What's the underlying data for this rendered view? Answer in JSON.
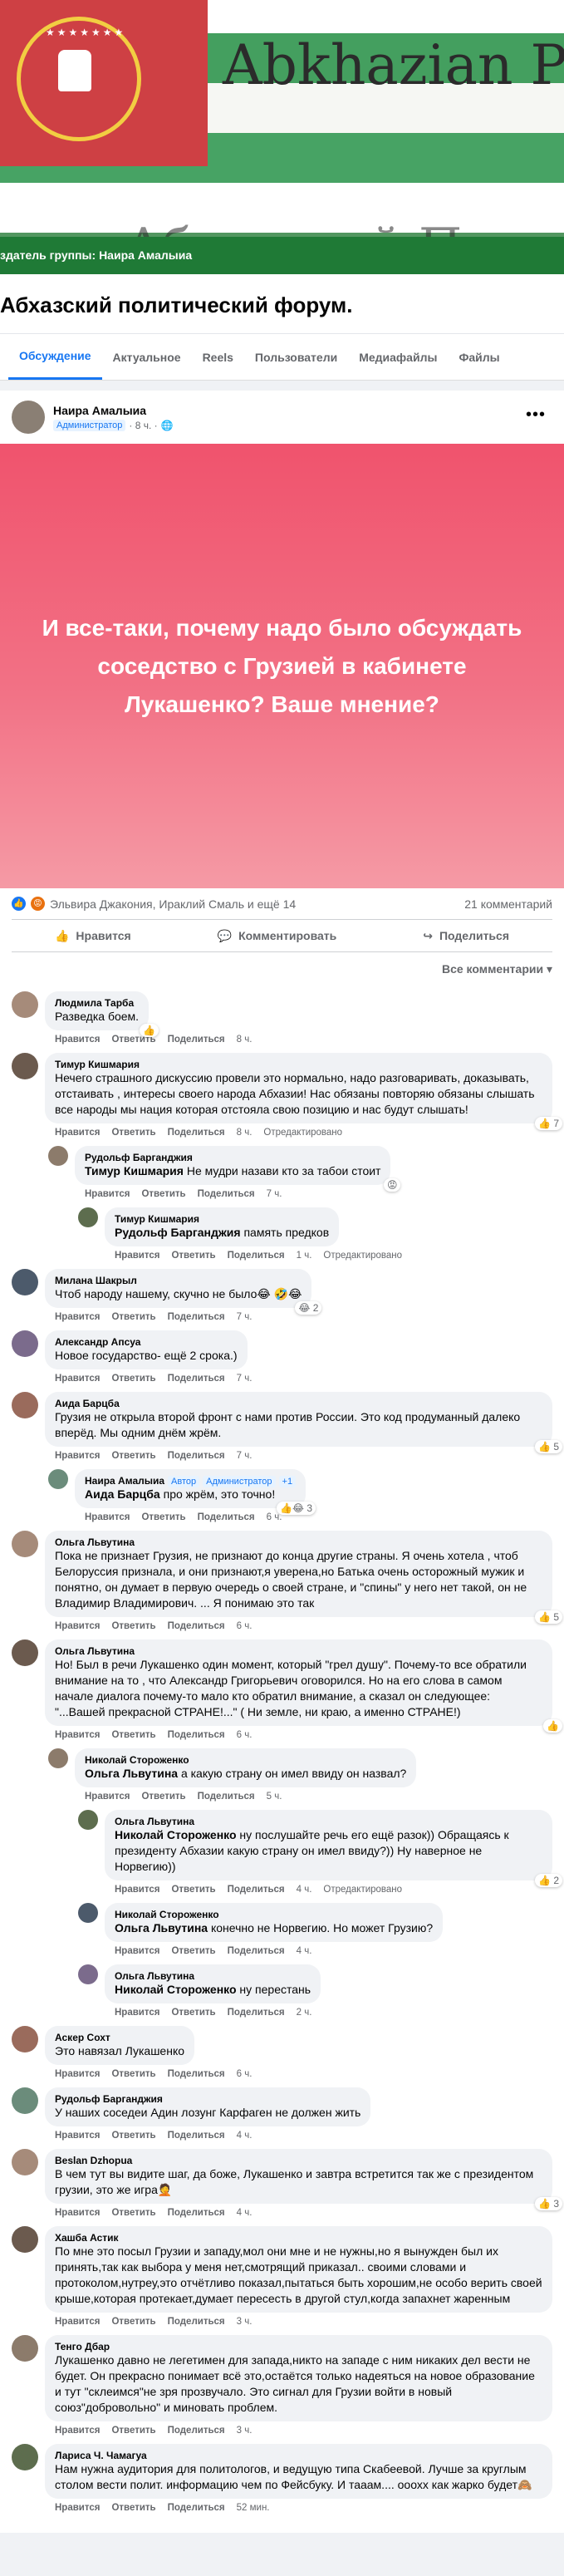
{
  "cover": {
    "brand": "Abkhazian Po",
    "brand_ghost": "Абхазский Полит",
    "admin_line": "здатель группы: Наира Амалыиа"
  },
  "group": {
    "title": "Абхазский политический форум.",
    "tabs": [
      "Обсуждение",
      "Актуальное",
      "Reels",
      "Пользователи",
      "Медиафайлы",
      "Файлы"
    ]
  },
  "post": {
    "author": "Наира Амалыиа",
    "role": "Администратор",
    "time": "· 8 ч. ·",
    "banner_text": "И все-таки, почему надо было обсуждать соседство с Грузией в кабинете Лукашенко? Ваше мнение?",
    "reactions_text": "Эльвира Джакония, Ираклий Смаль и ещё 14",
    "comments_count": "21 комментарий",
    "actions": {
      "like": "Нравится",
      "comment": "Комментировать",
      "share": "Поделиться"
    },
    "sort_label": "Все комментарии"
  },
  "comment_actions": {
    "like": "Нравится",
    "reply": "Ответить",
    "share": "Поделиться",
    "edited": "Отредактировано"
  },
  "comments": [
    {
      "name": "Людмила Тарба",
      "text": "Разведка боем.",
      "time": "8 ч.",
      "level": 0,
      "react": "👍"
    },
    {
      "name": "Тимур Кишмария",
      "text": "Нечего страшного дискуссию провели это нормально, надо разговаривать, доказывать, отстаивать , интересы своего народа Абхазии! Нас обязаны повторяю обязаны слышать все народы мы нация которая отстояла свою позицию и нас будут слышать!",
      "time": "8 ч.",
      "edited": true,
      "level": 0,
      "react": "👍 7"
    },
    {
      "name": "Рудольф Барганджия",
      "tag": "Тимур Кишмария",
      "text": "Не мудри назави кто за табои стоит",
      "time": "7 ч.",
      "level": 1,
      "react": "😡"
    },
    {
      "name": "Тимур Кишмария",
      "tag": "Рудольф Барганджия",
      "text": "память предков",
      "time": "1 ч.",
      "edited": true,
      "level": 2
    },
    {
      "name": "Милана Шакрыл",
      "text": "Чтоб народу нашему, скучно не было😂 🤣😂",
      "time": "7 ч.",
      "level": 0,
      "react": "😂 2"
    },
    {
      "name": "Александр Апсуа",
      "text": "Новое государство- ещё 2 срока.)",
      "time": "7 ч.",
      "level": 0
    },
    {
      "name": "Аида Барцба",
      "text": "Грузия не открыла второй фронт с нами против России. Это код продуманный далеко вперёд. Мы одним днём жрём.",
      "time": "7 ч.",
      "level": 0,
      "react": "👍 5"
    },
    {
      "name": "Наира Амалыиа",
      "author_badges": [
        "Автор",
        "Администратор",
        "+1"
      ],
      "tag": "Аида Барцба",
      "text": "про жрём, это точно!",
      "time": "6 ч.",
      "level": 1,
      "react": "👍😂 3"
    },
    {
      "name": "Ольга Львутина",
      "text": "Пока не признает Грузия, не признают до конца другие страны. Я очень хотела , чтоб Белоруссия признала, и они признают,я уверена,но Батька очень осторожный мужик и понятно, он думает в первую очередь о своей стране, и \"спины\" у него нет такой, он не Владимир Владимирович. ... Я понимаю это так",
      "time": "6 ч.",
      "level": 0,
      "react": "👍 5"
    },
    {
      "name": "Ольга Львутина",
      "text": "Но! Был в речи Лукашенко один момент, который \"грел душу\". Почему-то все обратили внимание на то , что Александр Григорьевич оговорился. Но на его слова в самом начале диалога почему-то мало кто обратил внимание, а сказал он следующее: \"...Вашей прекрасной СТРАНЕ!...\" ( Ни земле, ни краю, а именно СТРАНЕ!)",
      "time": "6 ч.",
      "level": 0,
      "react": "👍"
    },
    {
      "name": "Николай Стороженко",
      "tag": "Ольга Львутина",
      "text": "а какую страну он имел ввиду он назвал?",
      "time": "5 ч.",
      "level": 1
    },
    {
      "name": "Ольга Львутина",
      "tag": "Николай Стороженко",
      "text": "ну послушайте речь его ещё разок)) Обращаясь к президенту Абхазии какую страну он имел ввиду?)) Ну наверное не Норвегию))",
      "time": "4 ч.",
      "edited": true,
      "level": 2,
      "react": "👍 2"
    },
    {
      "name": "Николай Стороженко",
      "tag": "Ольга Львутина",
      "text": "конечно не Норвегию. Но может Грузию?",
      "time": "4 ч.",
      "level": 2
    },
    {
      "name": "Ольга Львутина",
      "tag": "Николай Стороженко",
      "text": "ну перестань",
      "time": "2 ч.",
      "level": 2
    },
    {
      "name": "Аскер Сохт",
      "text": "Это навязал Лукашенко",
      "time": "6 ч.",
      "level": 0
    },
    {
      "name": "Рудольф Барганджия",
      "text": "У наших соседеи Адин лозунг Карфаген не должен жить",
      "time": "4 ч.",
      "level": 0
    },
    {
      "name": "Beslan Dzhopua",
      "text": "В чем тут вы видите шаг, да боже, Лукашенко и завтра встретится так же с президентом грузии, это же игра🤦",
      "time": "4 ч.",
      "level": 0,
      "react": "👍 3"
    },
    {
      "name": "Хашба Астик",
      "text": "По мне это посыл Грузии и западу,мол они мне и не нужны,но я вынужден был их принять,так как выбора у меня нет,смотрящий приказал.. своими словами и протоколом,нутреу,это отчётливо показал,пытаться быть хорошим,не особо верить своей крыше,которая протекает,думает пересесть в другой стул,когда запахнет жаренным",
      "time": "3 ч.",
      "level": 0
    },
    {
      "name": "Тенго Дбар",
      "text": "Лукашенко давно не легетимен для запада,никто на западе с ним никаких дел вести не будет. Он прекрасно понимает всё это,остаётся только надеяться на новое образование и тут \"склеимся\"не зря прозвучало. Это сигнал для Грузии войти в новый союз\"добровольно\" и миновать проблем.",
      "time": "3 ч.",
      "level": 0
    },
    {
      "name": "Лариса Ч. Чамагуа",
      "text": "Нам нужна аудитория для политологов, и ведущую типа Скабеевой. Лучше за круглым столом вести полит. информацию чем по Фейсбуку. И тааам.... ооохх как жарко будет🙈",
      "time": "52 мин.",
      "level": 0
    }
  ],
  "colors": {
    "accent": "#1877f2",
    "banner_top": "#f0536d",
    "banner_bottom": "#f59aa5",
    "cover_green": "#1f7a36"
  }
}
